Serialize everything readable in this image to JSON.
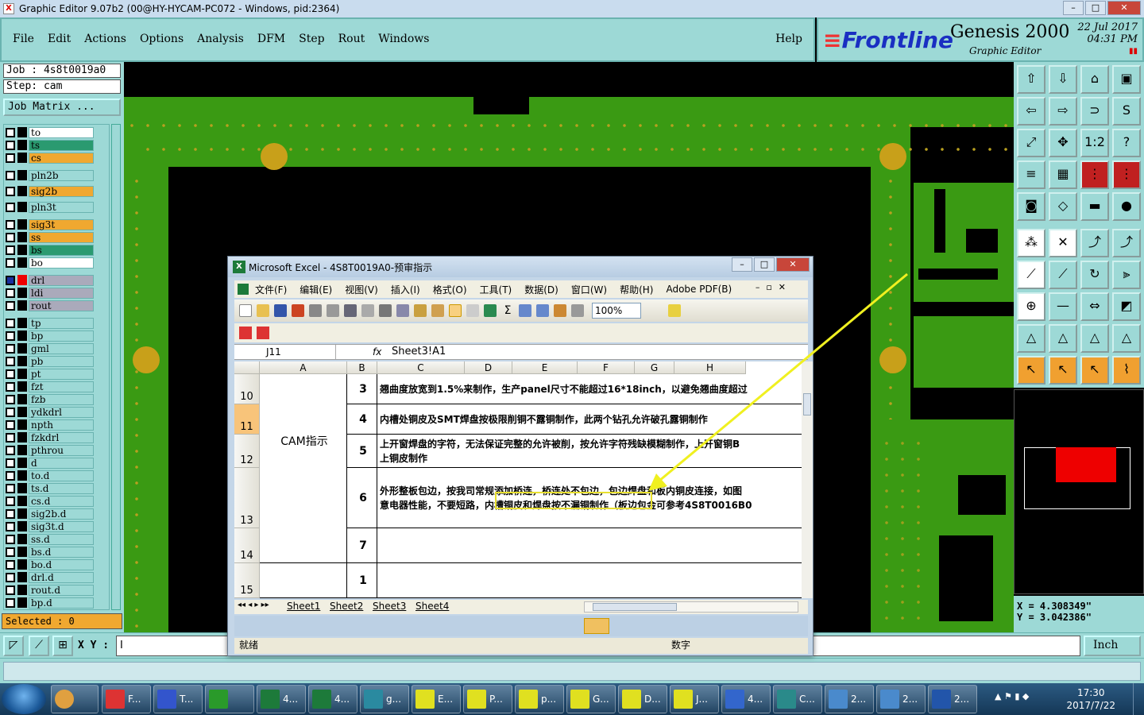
{
  "window_title": "Graphic Editor 9.07b2 (00@HY-HYCAM-PC072 - Windows, pid:2364)",
  "menu": [
    "File",
    "Edit",
    "Actions",
    "Options",
    "Analysis",
    "DFM",
    "Step",
    "Rout",
    "Windows"
  ],
  "help": "Help",
  "brand": {
    "logo": "Frontline",
    "product": "Genesis 2000",
    "subtitle": "Graphic Editor",
    "date": "22 Jul 2017",
    "time": "04:31 PM"
  },
  "job": {
    "job_label": "Job : 4s8t0019a0",
    "step_label": "Step: cam",
    "matrix_button": "Job Matrix ..."
  },
  "layers": [
    "to",
    "ts",
    "cs",
    "pln2b",
    "sig2b",
    "pln3t",
    "sig3t",
    "ss",
    "bs",
    "bo",
    "drl",
    "ldi",
    "rout",
    "tp",
    "bp",
    "gml",
    "pb",
    "pt",
    "fzt",
    "fzb",
    "ydkdrl",
    "npth",
    "fzkdrl",
    "pthrou",
    "d",
    "to.d",
    "ts.d",
    "cs.d",
    "sig2b.d",
    "sig3t.d",
    "ss.d",
    "bs.d",
    "bo.d",
    "drl.d",
    "rout.d",
    "bp.d"
  ],
  "selected": "Selected : 0",
  "coords": {
    "x": "X = 4.308349\"",
    "y": "Y = 3.042386\""
  },
  "xy_label": "X Y :",
  "xy_value": "I",
  "unit": "Inch",
  "excel": {
    "title": "Microsoft Excel - 4S8T0019A0-预审指示",
    "menu": [
      "文件(F)",
      "编辑(E)",
      "视图(V)",
      "插入(I)",
      "格式(O)",
      "工具(T)",
      "数据(D)",
      "窗口(W)",
      "帮助(H)",
      "Adobe PDF(B)"
    ],
    "zoom": "100%",
    "namebox": "J11",
    "fx": "fx",
    "formula": "Sheet3!A1",
    "columns": [
      "A",
      "B",
      "C",
      "D",
      "E",
      "F",
      "G",
      "H"
    ],
    "rows": [
      "10",
      "11",
      "12",
      "13",
      "14",
      "15"
    ],
    "merged_a": "CAM指示",
    "items": [
      {
        "num": "3",
        "text": "翘曲度放宽到1.5%来制作，生产panel尺寸不能超过16*18inch，以避免翘曲度超过"
      },
      {
        "num": "4",
        "text": "内槽处铜皮及SMT焊盘按极限削铜不露铜制作，此两个钻孔允许破孔露铜制作"
      },
      {
        "num": "5",
        "text": "上开窗焊盘的字符，无法保证完整的允许被削，按允许字符残缺模糊制作，上开窗铜B",
        "text2": "上铜皮制作"
      },
      {
        "num": "6",
        "text": "外形整板包边，按我司常规添加桥连，桥连处不包边，包边焊盘和板内铜皮连接，如图",
        "text2": "意电器性能，不要短路，内槽铜皮和焊盘按不漏铜制作（板边包金可参考4S8T0016B0"
      },
      {
        "num": "7",
        "text": ""
      },
      {
        "num": "1",
        "text": ""
      }
    ],
    "tabs": [
      "Sheet1",
      "Sheet2",
      "Sheet3",
      "Sheet4"
    ],
    "status_left": "就绪",
    "status_right": "数字"
  },
  "taskbar": [
    {
      "label": "F...",
      "color": "#d33"
    },
    {
      "label": "T...",
      "color": "#3355cc"
    },
    {
      "label": "",
      "color": "#2a9a2a"
    },
    {
      "label": "4...",
      "color": "#1d7a3a"
    },
    {
      "label": "4...",
      "color": "#1d7a3a"
    },
    {
      "label": "g...",
      "color": "#2a8aa0"
    },
    {
      "label": "E...",
      "color": "#e0e020"
    },
    {
      "label": "P...",
      "color": "#e0e020"
    },
    {
      "label": "p...",
      "color": "#e0e020"
    },
    {
      "label": "G...",
      "color": "#e0e020"
    },
    {
      "label": "D...",
      "color": "#e0e020"
    },
    {
      "label": "J...",
      "color": "#e0e020"
    },
    {
      "label": "4...",
      "color": "#3366cc"
    },
    {
      "label": "C...",
      "color": "#2a8a8a"
    },
    {
      "label": "2...",
      "color": "#4a8acc"
    },
    {
      "label": "2...",
      "color": "#4a8acc"
    },
    {
      "label": "2...",
      "color": "#2255aa"
    }
  ],
  "clock": {
    "time": "17:30",
    "date": "2017/7/22"
  }
}
